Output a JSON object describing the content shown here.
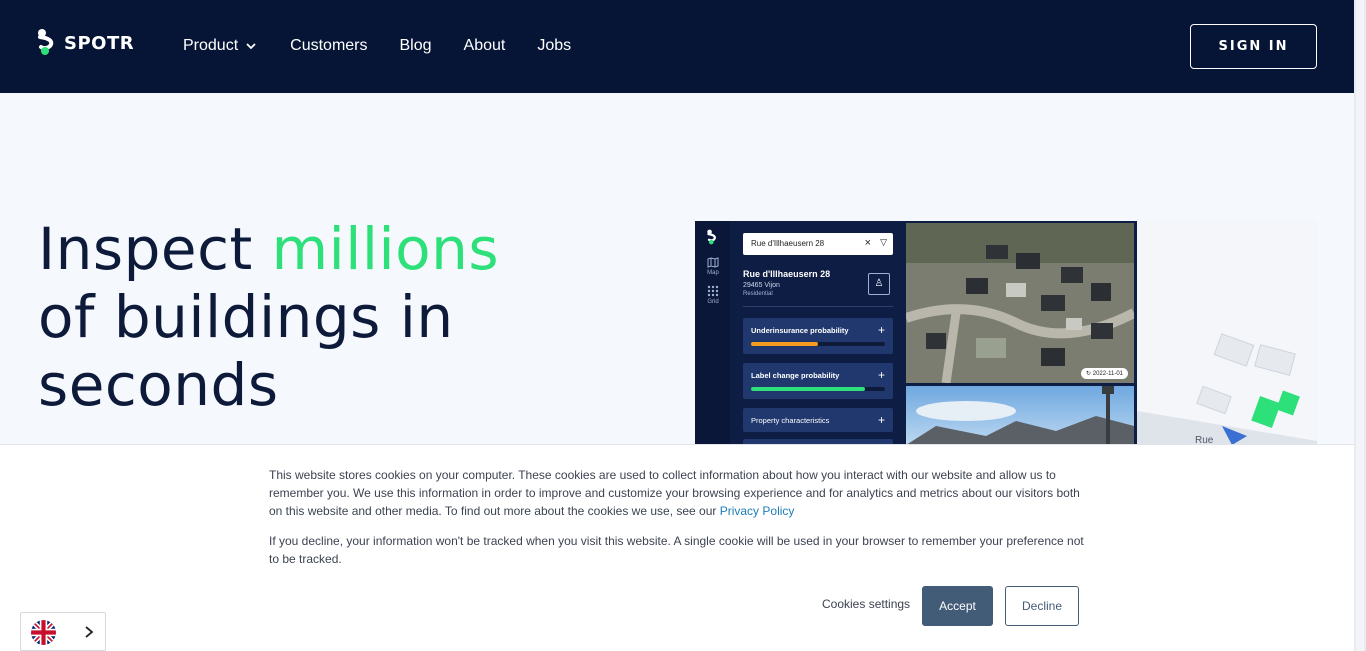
{
  "brand": {
    "name": "SPOTR",
    "accent": "#2ee07a",
    "navy": "#061536"
  },
  "nav": {
    "items": [
      {
        "label": "Product"
      },
      {
        "label": "Customers"
      },
      {
        "label": "Blog"
      },
      {
        "label": "About"
      },
      {
        "label": "Jobs"
      }
    ],
    "signin_label": "SIGN IN"
  },
  "hero": {
    "title_part1": "Inspect ",
    "title_accent": "millions",
    "title_part2": "of buildings in",
    "title_part3": "seconds"
  },
  "app_preview": {
    "search_value": "Rue d'Illhaeusern 28",
    "rail": {
      "map_label": "Map",
      "grid_label": "Grid"
    },
    "address": {
      "line1": "Rue d'Illhaeusern 28",
      "line2": "29465 Vijon",
      "line3": "Residential"
    },
    "cards": [
      {
        "label": "Underinsurance probability",
        "fill_percent": 50,
        "color": "#f39c1f"
      },
      {
        "label": "Label change probability",
        "fill_percent": 85,
        "color": "#2ee07a"
      },
      {
        "label": "Property characteristics"
      }
    ],
    "image_date": "2022-11-01",
    "map_street_label": "Rue"
  },
  "cookie_banner": {
    "paragraph1": "This website stores cookies on your computer. These cookies are used to collect information about how you interact with our website and allow us to remember you. We use this information in order to improve and customize your browsing experience and for analytics and metrics about our visitors both on this website and other media. To find out more about the cookies we use, see our ",
    "privacy_link": "Privacy Policy",
    "paragraph2": "If you decline, your information won't be tracked when you visit this website. A single cookie will be used in your browser to remember your preference not to be tracked.",
    "settings_label": "Cookies settings",
    "accept_label": "Accept",
    "decline_label": "Decline"
  },
  "language": {
    "flag_icon": "uk-flag-icon"
  }
}
